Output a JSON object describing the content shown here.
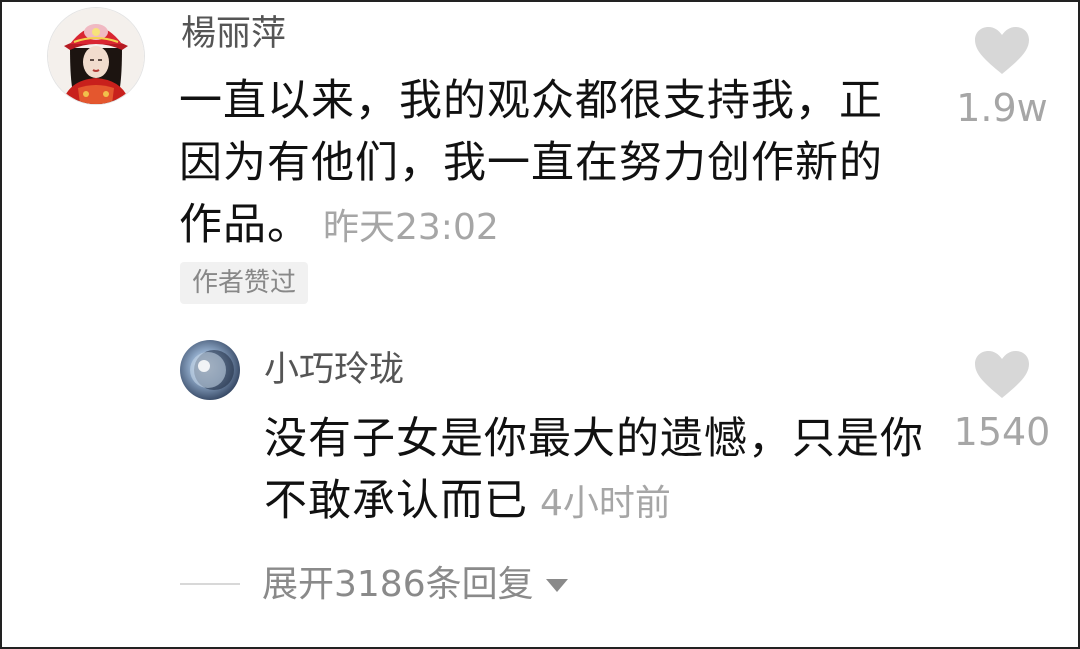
{
  "main_comment": {
    "username": "楊丽萍",
    "text": "一直以来，我的观众都很支持我，正因为有他们，我一直在努力创作新的作品。",
    "time": "昨天23:02",
    "badge": "作者赞过",
    "like_count": "1.9w",
    "avatar_icon": "user-avatar-red-headdress"
  },
  "reply": {
    "username": "小巧玲珑",
    "text": "没有子女是你最大的遗憾，只是你不敢承认而已",
    "time": "4小时前",
    "like_count": "1540",
    "avatar_icon": "user-avatar-moon-sky"
  },
  "expand": {
    "label": "展开3186条回复",
    "icon": "caret-down-icon"
  },
  "colors": {
    "text_primary": "#111111",
    "text_secondary": "#a6a6a6",
    "username": "#555555",
    "heart": "#d7d7d7",
    "badge_bg": "#f1f1f1"
  }
}
